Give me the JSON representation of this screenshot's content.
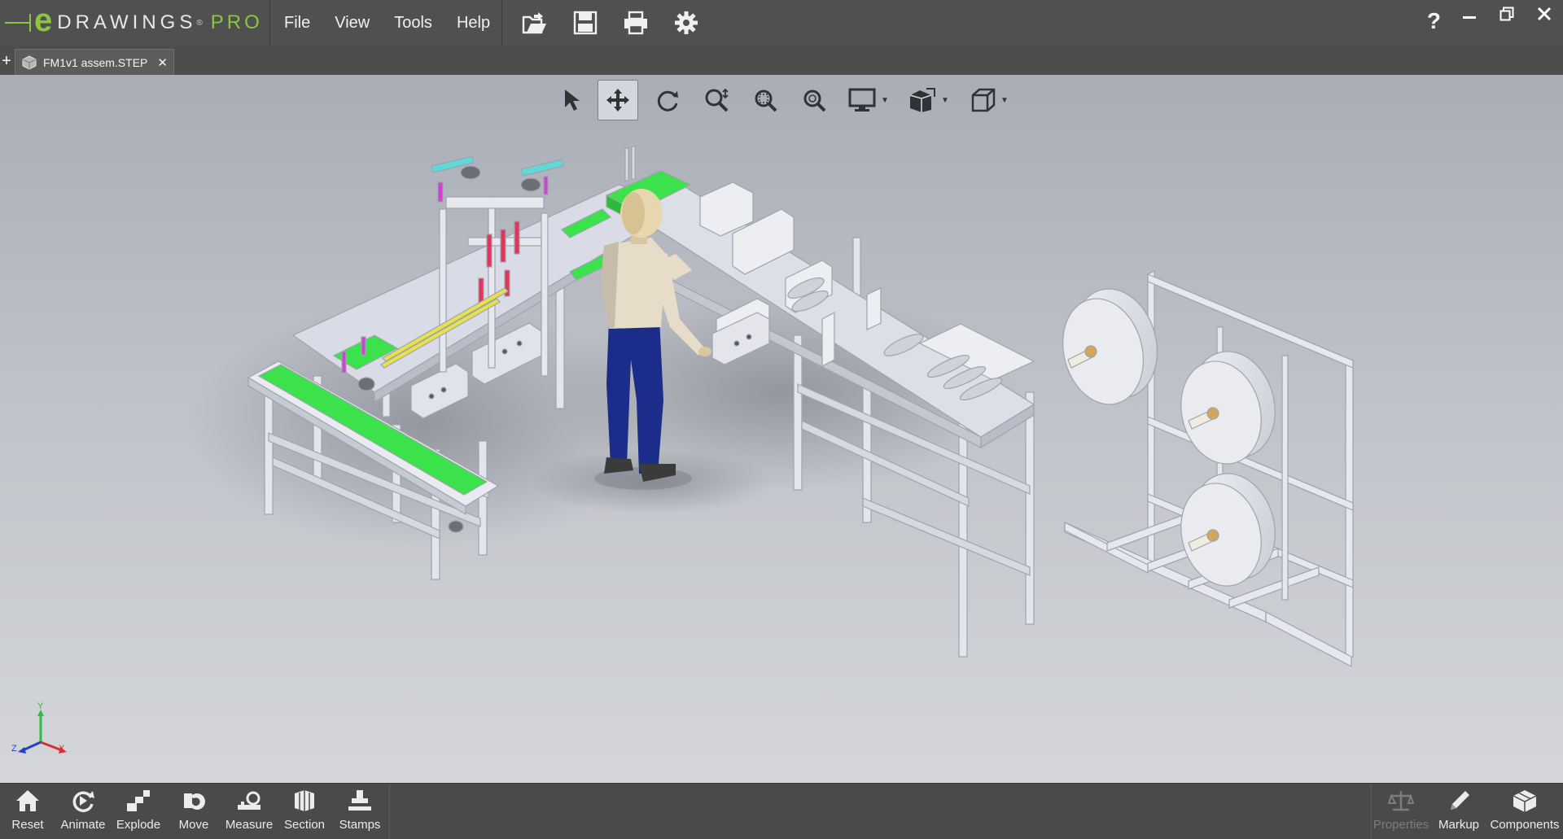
{
  "app": {
    "logo_name": "DRAWINGS",
    "logo_reg": "®",
    "logo_pro": "PRO",
    "help_label": "?"
  },
  "menu": [
    "File",
    "View",
    "Tools",
    "Help"
  ],
  "quick_actions": [
    "open-icon",
    "save-icon",
    "print-icon",
    "settings-icon"
  ],
  "window_controls": [
    "minimize-icon",
    "restore-icon",
    "close-icon"
  ],
  "tab": {
    "new_label": "+",
    "title": "FM1v1 assem.STEP",
    "close_label": "✕"
  },
  "view_toolbar": {
    "tools": [
      "select",
      "pan",
      "rotate",
      "zoom",
      "zoom-to-area",
      "zoom-to-fit",
      "display-style",
      "view-orientation",
      "standard-views"
    ],
    "active": "pan"
  },
  "triad": {
    "x": "X",
    "y": "Y",
    "z": "Z"
  },
  "bottom_toolbar": {
    "left": [
      {
        "icon": "home-icon",
        "label": "Reset"
      },
      {
        "icon": "animate-icon",
        "label": "Animate"
      },
      {
        "icon": "explode-icon",
        "label": "Explode"
      },
      {
        "icon": "move-icon",
        "label": "Move"
      },
      {
        "icon": "measure-icon",
        "label": "Measure"
      },
      {
        "icon": "section-icon",
        "label": "Section"
      },
      {
        "icon": "stamps-icon",
        "label": "Stamps"
      }
    ],
    "right": [
      {
        "icon": "properties-icon",
        "label": "Properties",
        "disabled": true
      },
      {
        "icon": "markup-icon",
        "label": "Markup"
      },
      {
        "icon": "components-icon",
        "label": "Components"
      }
    ]
  },
  "colors": {
    "chrome": "#505050",
    "accent_green": "#8cc63f",
    "conveyor_green": "#39e84a",
    "frame": "#cfd3dc",
    "worker_shirt": "#e3d8c4",
    "worker_pants": "#1f2f8a"
  }
}
